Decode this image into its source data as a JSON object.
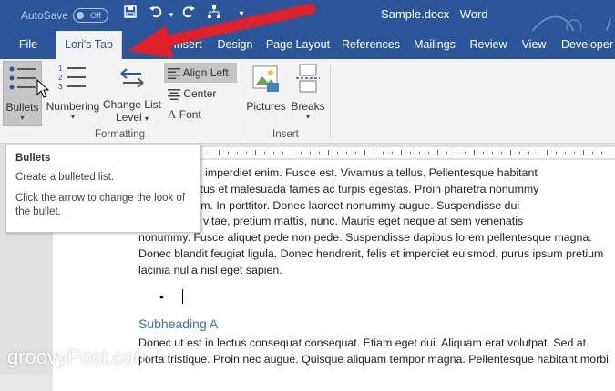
{
  "titlebar": {
    "autosave_label": "AutoSave",
    "autosave_state": "Off",
    "document_title": "Sample.docx - Word"
  },
  "tabs": [
    {
      "label": "File"
    },
    {
      "label": "Lori's Tab"
    },
    {
      "label": "Insert"
    },
    {
      "label": "Design"
    },
    {
      "label": "Page Layout"
    },
    {
      "label": "References"
    },
    {
      "label": "Mailings"
    },
    {
      "label": "Review"
    },
    {
      "label": "View"
    },
    {
      "label": "Developer"
    }
  ],
  "ribbon": {
    "bullets_label": "Bullets",
    "numbering_label": "Numbering",
    "change_list_label_1": "Change List",
    "change_list_label_2": "Level",
    "align_left_label": "Align Left",
    "center_label": "Center",
    "font_label": "Font",
    "formatting_group": "Formatting",
    "pictures_label": "Pictures",
    "breaks_label": "Breaks",
    "insert_group": "Insert"
  },
  "tooltip": {
    "title": "Bullets",
    "line1": "Create a bulleted list.",
    "line2": "Click the arrow to change the look of the bullet."
  },
  "document": {
    "paragraph1": [
      "Nunc viverra imperdiet enim. Fusce est. Vivamus a tellus. Pellentesque habitant",
      "nectus et netus et malesuada fames ac turpis egestas. Proin pharetra nonummy",
      "ean nec lorem. In porttitor. Donec laoreet nonummy augue. Suspendisse dui",
      "at, vulputate vitae, pretium mattis, nunc. Mauris eget neque at sem venenatis",
      "nonummy. Fusce aliquet pede non pede. Suspendisse dapibus lorem pellentesque magna.",
      "Donec blandit feugiat ligula. Donec hendrerit, felis et imperdiet euismod, purus ipsum pretium",
      "lacinia nulla nisl eget sapien."
    ],
    "bullet_char": "•",
    "subheading": "Subheading A",
    "paragraph2": [
      "Donec ut est in lectus consequat consequat. Etiam eget dui. Aliquam erat volutpat. Sed at",
      "porta tristique. Proin nec augue. Quisque aliquam tempor magna. Pellentesque habitant morbi"
    ]
  },
  "watermark": "groovyPost.com",
  "colors": {
    "word_blue": "#2b579a",
    "arrow_red": "#e0202a",
    "heading_blue": "#2e74b5"
  }
}
